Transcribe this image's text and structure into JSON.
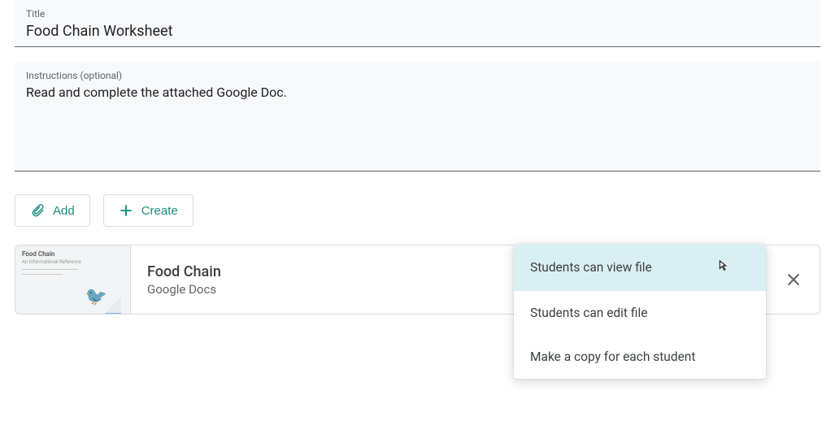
{
  "fields": {
    "title_label": "Title",
    "title_value": "Food Chain Worksheet",
    "instructions_label": "Instructions (optional)",
    "instructions_value": "Read and complete the attached Google Doc."
  },
  "actions": {
    "add_label": "Add",
    "create_label": "Create"
  },
  "attachment": {
    "name": "Food Chain",
    "source": "Google Docs",
    "thumb_title": "Food Chain",
    "thumb_sub": "An Informational Reference"
  },
  "permissions": {
    "view": "Students can view file",
    "edit": "Students can edit file",
    "copy": "Make a copy for each student"
  }
}
